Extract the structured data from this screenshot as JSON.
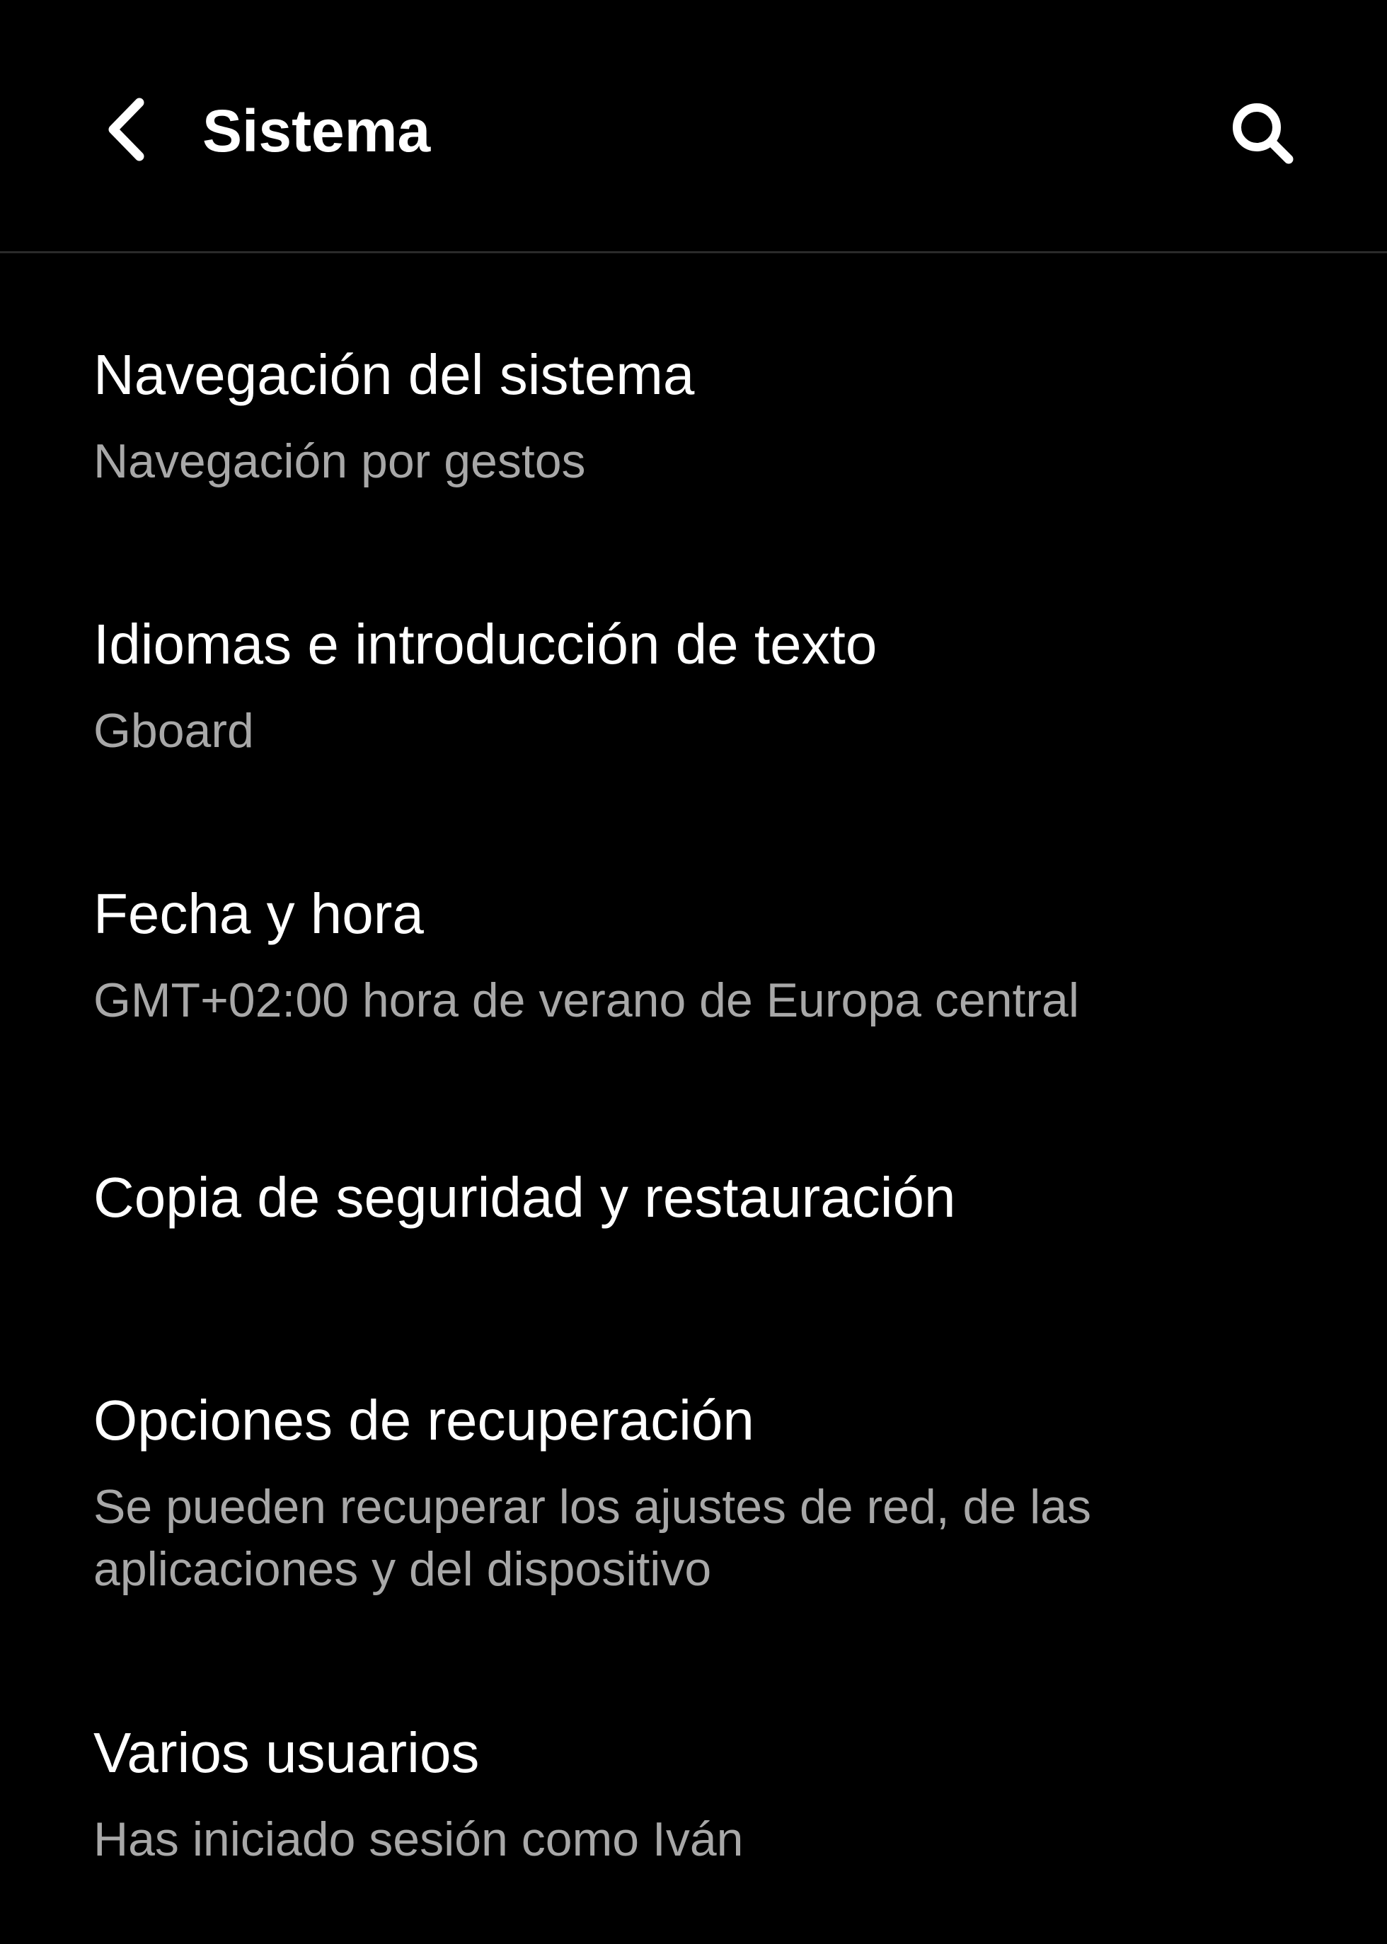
{
  "header": {
    "title": "Sistema",
    "back_icon": "chevron-left-icon",
    "search_icon": "search-icon"
  },
  "settings": {
    "items": [
      {
        "title": "Navegación del sistema",
        "summary": "Navegación por gestos"
      },
      {
        "title": "Idiomas e introducción de texto",
        "summary": "Gboard"
      },
      {
        "title": "Fecha y hora",
        "summary": "GMT+02:00 hora de verano de Europa central"
      },
      {
        "title": "Copia de seguridad y restauración"
      },
      {
        "title": "Opciones de recuperación",
        "summary": "Se pueden recuperar los ajustes de red, de las aplicaciones y del dispositivo"
      },
      {
        "title": "Varios usuarios",
        "summary": "Has iniciado sesión como Iván"
      }
    ]
  },
  "colors": {
    "background": "#000000",
    "title_text": "#ffffff",
    "summary_text": "#a8a8a8",
    "divider": "#2a2a2a"
  }
}
